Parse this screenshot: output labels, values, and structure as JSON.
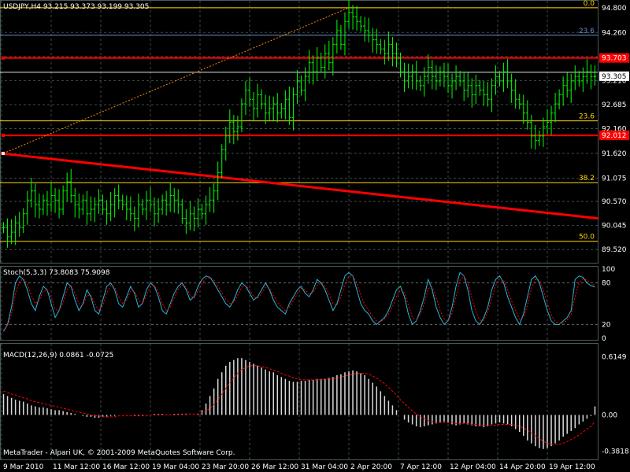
{
  "chart_data": [
    {
      "type": "candlestick",
      "pane": "price",
      "title": "USDJPY,H4",
      "header_values": [
        "93.215",
        "93.373",
        "93.199",
        "93.305"
      ],
      "current_price": 93.305,
      "ylim": [
        89.3,
        94.9
      ],
      "y_ticks": [
        "94.800",
        "94.260",
        "93.735",
        "93.210",
        "92.685",
        "92.160",
        "91.620",
        "91.075",
        "90.570",
        "90.045",
        "89.520"
      ],
      "fibonacci_levels": [
        {
          "label": "0.0",
          "price": 94.8,
          "color": "#ffd700"
        },
        {
          "label": "23.6",
          "price": 94.2,
          "color": "#6a8cc8"
        },
        {
          "label": "23.6",
          "price": 92.33,
          "color": "#ffd700"
        },
        {
          "label": "38.2",
          "price": 90.98,
          "color": "#ffd700"
        },
        {
          "label": "50.0",
          "price": 89.7,
          "color": "#ffd700"
        }
      ],
      "horizontal_lines": [
        {
          "label": "93.703",
          "price": 93.703,
          "color": "#ff0000"
        },
        {
          "label": "92.012",
          "price": 92.012,
          "color": "#ff0000"
        }
      ],
      "white_line_price": 93.39,
      "trendline": {
        "from_index": 0,
        "from_price": 91.62,
        "to_index": 149,
        "to_price": 90.2,
        "color": "#ff0000"
      },
      "fib_anchor_line": {
        "from_index": 0,
        "from_price": 91.62,
        "to_index": 87,
        "to_price": 94.8,
        "color": "#ff8c00"
      },
      "close_series": [
        90.0,
        89.8,
        89.9,
        90.1,
        90.0,
        90.3,
        90.6,
        90.8,
        90.5,
        90.4,
        90.6,
        90.5,
        90.7,
        90.6,
        90.4,
        90.8,
        91.0,
        90.7,
        90.5,
        90.4,
        90.6,
        90.3,
        90.4,
        90.5,
        90.6,
        90.4,
        90.3,
        90.5,
        90.7,
        90.6,
        90.5,
        90.4,
        90.3,
        90.2,
        90.5,
        90.4,
        90.6,
        90.5,
        90.3,
        90.4,
        90.6,
        90.5,
        90.7,
        90.6,
        90.5,
        90.2,
        90.1,
        90.3,
        90.2,
        90.4,
        90.3,
        90.5,
        90.6,
        90.8,
        91.2,
        91.7,
        92.0,
        92.3,
        92.1,
        92.2,
        92.7,
        93.0,
        92.8,
        92.6,
        92.9,
        92.7,
        92.5,
        92.6,
        92.7,
        92.5,
        92.6,
        92.8,
        92.4,
        92.9,
        93.2,
        93.0,
        93.3,
        93.6,
        93.4,
        93.7,
        93.5,
        93.8,
        93.6,
        94.0,
        94.3,
        94.0,
        94.5,
        94.7,
        94.6,
        94.5,
        94.4,
        94.3,
        94.2,
        94.1,
        94.0,
        93.9,
        93.8,
        94.0,
        93.8,
        93.7,
        93.4,
        93.2,
        93.3,
        93.4,
        93.2,
        93.1,
        93.3,
        93.5,
        93.3,
        93.2,
        93.4,
        93.3,
        93.1,
        93.2,
        93.3,
        93.2,
        93.0,
        93.1,
        92.9,
        93.1,
        93.0,
        92.9,
        92.8,
        93.1,
        93.3,
        93.2,
        93.4,
        93.2,
        93.0,
        92.8,
        92.7,
        92.5,
        92.3,
        92.0,
        91.9,
        92.0,
        92.2,
        92.3,
        92.5,
        92.7,
        92.9,
        93.1,
        93.0,
        93.2,
        93.3,
        93.2,
        93.3,
        93.4,
        93.3,
        93.3
      ],
      "x_tick_labels": [
        "9 Mar 2010",
        "11 Mar 12:00",
        "16 Mar 12:00",
        "19 Mar 04:00",
        "23 Mar 20:00",
        "26 Mar 12:00",
        "31 Mar 04:00",
        "2 Apr 20:00",
        "7 Apr 12:00",
        "12 Apr 04:00",
        "14 Apr 20:00",
        "19 Apr 12:00"
      ],
      "line_color": "#00ff00"
    },
    {
      "type": "line",
      "pane": "stochastic",
      "title": "Stoch(5,3,3)",
      "header_values": [
        "73.8083",
        "75.9098"
      ],
      "y_ticks": [
        "100",
        "80",
        "20",
        "0"
      ],
      "ylim": [
        0,
        100
      ],
      "levels": [
        80,
        20
      ],
      "series": [
        {
          "values": [
            10,
            20,
            45,
            80,
            90,
            85,
            70,
            50,
            40,
            60,
            75,
            70,
            50,
            30,
            40,
            60,
            80,
            75,
            55,
            40,
            50,
            70,
            60,
            40,
            35,
            55,
            75,
            80,
            70,
            50,
            45,
            60,
            75,
            65,
            45,
            50,
            70,
            80,
            75,
            60,
            40,
            35,
            50,
            65,
            75,
            80,
            70,
            55,
            60,
            75,
            85,
            90,
            88,
            80,
            70,
            60,
            50,
            45,
            55,
            70,
            80,
            75,
            65,
            55,
            60,
            70,
            80,
            70,
            55,
            45,
            40,
            35,
            50,
            60,
            70,
            75,
            65,
            60,
            70,
            85,
            80,
            70,
            55,
            40,
            50,
            70,
            90,
            95,
            90,
            70,
            50,
            40,
            35,
            25,
            20,
            25,
            30,
            40,
            55,
            70,
            75,
            60,
            35,
            20,
            25,
            40,
            60,
            85,
            70,
            45,
            30,
            20,
            25,
            45,
            75,
            95,
            90,
            70,
            40,
            25,
            20,
            30,
            45,
            70,
            85,
            90,
            80,
            60,
            45,
            30,
            20,
            35,
            60,
            85,
            90,
            80,
            60,
            40,
            25,
            20,
            20,
            25,
            30,
            40,
            85,
            90,
            88,
            80,
            76,
            74
          ]
        },
        {
          "values": [
            12,
            18,
            35,
            65,
            82,
            86,
            78,
            62,
            50,
            55,
            68,
            70,
            60,
            42,
            40,
            52,
            70,
            76,
            65,
            50,
            48,
            62,
            62,
            50,
            40,
            48,
            65,
            76,
            74,
            60,
            50,
            55,
            68,
            68,
            55,
            50,
            62,
            74,
            76,
            66,
            50,
            40,
            45,
            58,
            70,
            77,
            74,
            62,
            58,
            68,
            80,
            86,
            88,
            84,
            76,
            66,
            56,
            50,
            52,
            62,
            74,
            76,
            70,
            60,
            58,
            64,
            74,
            72,
            62,
            52,
            45,
            40,
            45,
            54,
            64,
            72,
            70,
            64,
            66,
            76,
            80,
            75,
            64,
            50,
            48,
            60,
            78,
            90,
            90,
            80,
            62,
            48,
            40,
            32,
            25,
            24,
            28,
            35,
            46,
            60,
            70,
            66,
            48,
            30,
            26,
            35,
            50,
            72,
            74,
            58,
            40,
            28,
            25,
            36,
            60,
            84,
            90,
            80,
            58,
            38,
            26,
            26,
            38,
            58,
            76,
            86,
            84,
            70,
            54,
            40,
            28,
            30,
            48,
            72,
            85,
            84,
            70,
            50,
            34,
            24,
            21,
            22,
            26,
            34,
            60,
            80,
            86,
            84,
            80,
            76
          ]
        }
      ],
      "colors": [
        "#2bb5d6",
        "#ff0000"
      ]
    },
    {
      "type": "bar",
      "pane": "macd",
      "title": "MACD(12,26,9)",
      "header_values": [
        "0.0861",
        "-0.0725"
      ],
      "y_ticks": [
        "0.6149",
        "0.00",
        "-0.3818"
      ],
      "ylim": [
        -0.42,
        0.66
      ],
      "histogram": [
        0.22,
        0.2,
        0.18,
        0.16,
        0.15,
        0.14,
        0.12,
        0.1,
        0.09,
        0.08,
        0.08,
        0.07,
        0.06,
        0.05,
        0.05,
        0.04,
        0.03,
        0.02,
        0.01,
        0.0,
        -0.01,
        -0.02,
        -0.02,
        -0.03,
        -0.03,
        -0.02,
        -0.02,
        -0.01,
        -0.01,
        0.0,
        0.0,
        0.0,
        0.0,
        -0.01,
        -0.01,
        -0.01,
        0.0,
        0.0,
        0.01,
        0.01,
        0.01,
        0.0,
        0.0,
        0.01,
        0.01,
        0.01,
        0.01,
        0.0,
        0.0,
        0.01,
        0.05,
        0.12,
        0.2,
        0.28,
        0.38,
        0.45,
        0.52,
        0.56,
        0.58,
        0.6,
        0.6,
        0.58,
        0.56,
        0.54,
        0.52,
        0.5,
        0.48,
        0.46,
        0.45,
        0.42,
        0.4,
        0.38,
        0.36,
        0.35,
        0.35,
        0.36,
        0.36,
        0.37,
        0.37,
        0.38,
        0.38,
        0.38,
        0.39,
        0.4,
        0.42,
        0.43,
        0.45,
        0.46,
        0.47,
        0.46,
        0.44,
        0.42,
        0.38,
        0.34,
        0.3,
        0.25,
        0.2,
        0.15,
        0.1,
        0.05,
        0.0,
        -0.05,
        -0.08,
        -0.1,
        -0.12,
        -0.13,
        -0.12,
        -0.11,
        -0.1,
        -0.09,
        -0.08,
        -0.07,
        -0.08,
        -0.1,
        -0.11,
        -0.1,
        -0.09,
        -0.1,
        -0.11,
        -0.12,
        -0.12,
        -0.13,
        -0.12,
        -0.1,
        -0.09,
        -0.08,
        -0.09,
        -0.1,
        -0.12,
        -0.15,
        -0.18,
        -0.22,
        -0.27,
        -0.3,
        -0.33,
        -0.35,
        -0.36,
        -0.35,
        -0.33,
        -0.3,
        -0.27,
        -0.23,
        -0.2,
        -0.17,
        -0.14,
        -0.1,
        -0.07,
        -0.04,
        -0.01,
        0.09
      ],
      "signal": [
        0.25,
        0.24,
        0.22,
        0.21,
        0.19,
        0.18,
        0.17,
        0.15,
        0.14,
        0.13,
        0.12,
        0.11,
        0.1,
        0.09,
        0.08,
        0.07,
        0.06,
        0.05,
        0.04,
        0.03,
        0.02,
        0.01,
        0.0,
        -0.01,
        -0.01,
        -0.02,
        -0.02,
        -0.02,
        -0.02,
        -0.01,
        -0.01,
        -0.01,
        -0.01,
        -0.01,
        -0.01,
        -0.01,
        -0.01,
        0.0,
        0.0,
        0.0,
        0.0,
        0.0,
        0.0,
        0.0,
        0.01,
        0.01,
        0.01,
        0.01,
        0.01,
        0.01,
        0.02,
        0.04,
        0.07,
        0.11,
        0.16,
        0.22,
        0.28,
        0.34,
        0.39,
        0.44,
        0.48,
        0.5,
        0.52,
        0.52,
        0.52,
        0.51,
        0.5,
        0.49,
        0.47,
        0.46,
        0.44,
        0.42,
        0.41,
        0.39,
        0.38,
        0.37,
        0.37,
        0.37,
        0.37,
        0.37,
        0.37,
        0.38,
        0.38,
        0.38,
        0.39,
        0.4,
        0.41,
        0.42,
        0.43,
        0.44,
        0.44,
        0.44,
        0.43,
        0.41,
        0.39,
        0.36,
        0.33,
        0.29,
        0.25,
        0.21,
        0.16,
        0.12,
        0.08,
        0.04,
        0.01,
        -0.02,
        -0.04,
        -0.06,
        -0.07,
        -0.08,
        -0.08,
        -0.08,
        -0.08,
        -0.08,
        -0.09,
        -0.09,
        -0.09,
        -0.09,
        -0.1,
        -0.1,
        -0.11,
        -0.11,
        -0.11,
        -0.11,
        -0.11,
        -0.1,
        -0.1,
        -0.1,
        -0.1,
        -0.11,
        -0.12,
        -0.14,
        -0.16,
        -0.19,
        -0.22,
        -0.25,
        -0.28,
        -0.3,
        -0.31,
        -0.31,
        -0.31,
        -0.3,
        -0.28,
        -0.26,
        -0.24,
        -0.21,
        -0.18,
        -0.15,
        -0.12,
        -0.07
      ],
      "bar_color": "#d9d9d9",
      "signal_color": "#ff0000"
    }
  ],
  "copyright": "MetaTrader - Alpari UK, © 2001-2009 MetaQuotes Software Corp.",
  "colors": {
    "background": "#000000",
    "grid": "#4a5a5a",
    "axis": "#ffffff"
  }
}
